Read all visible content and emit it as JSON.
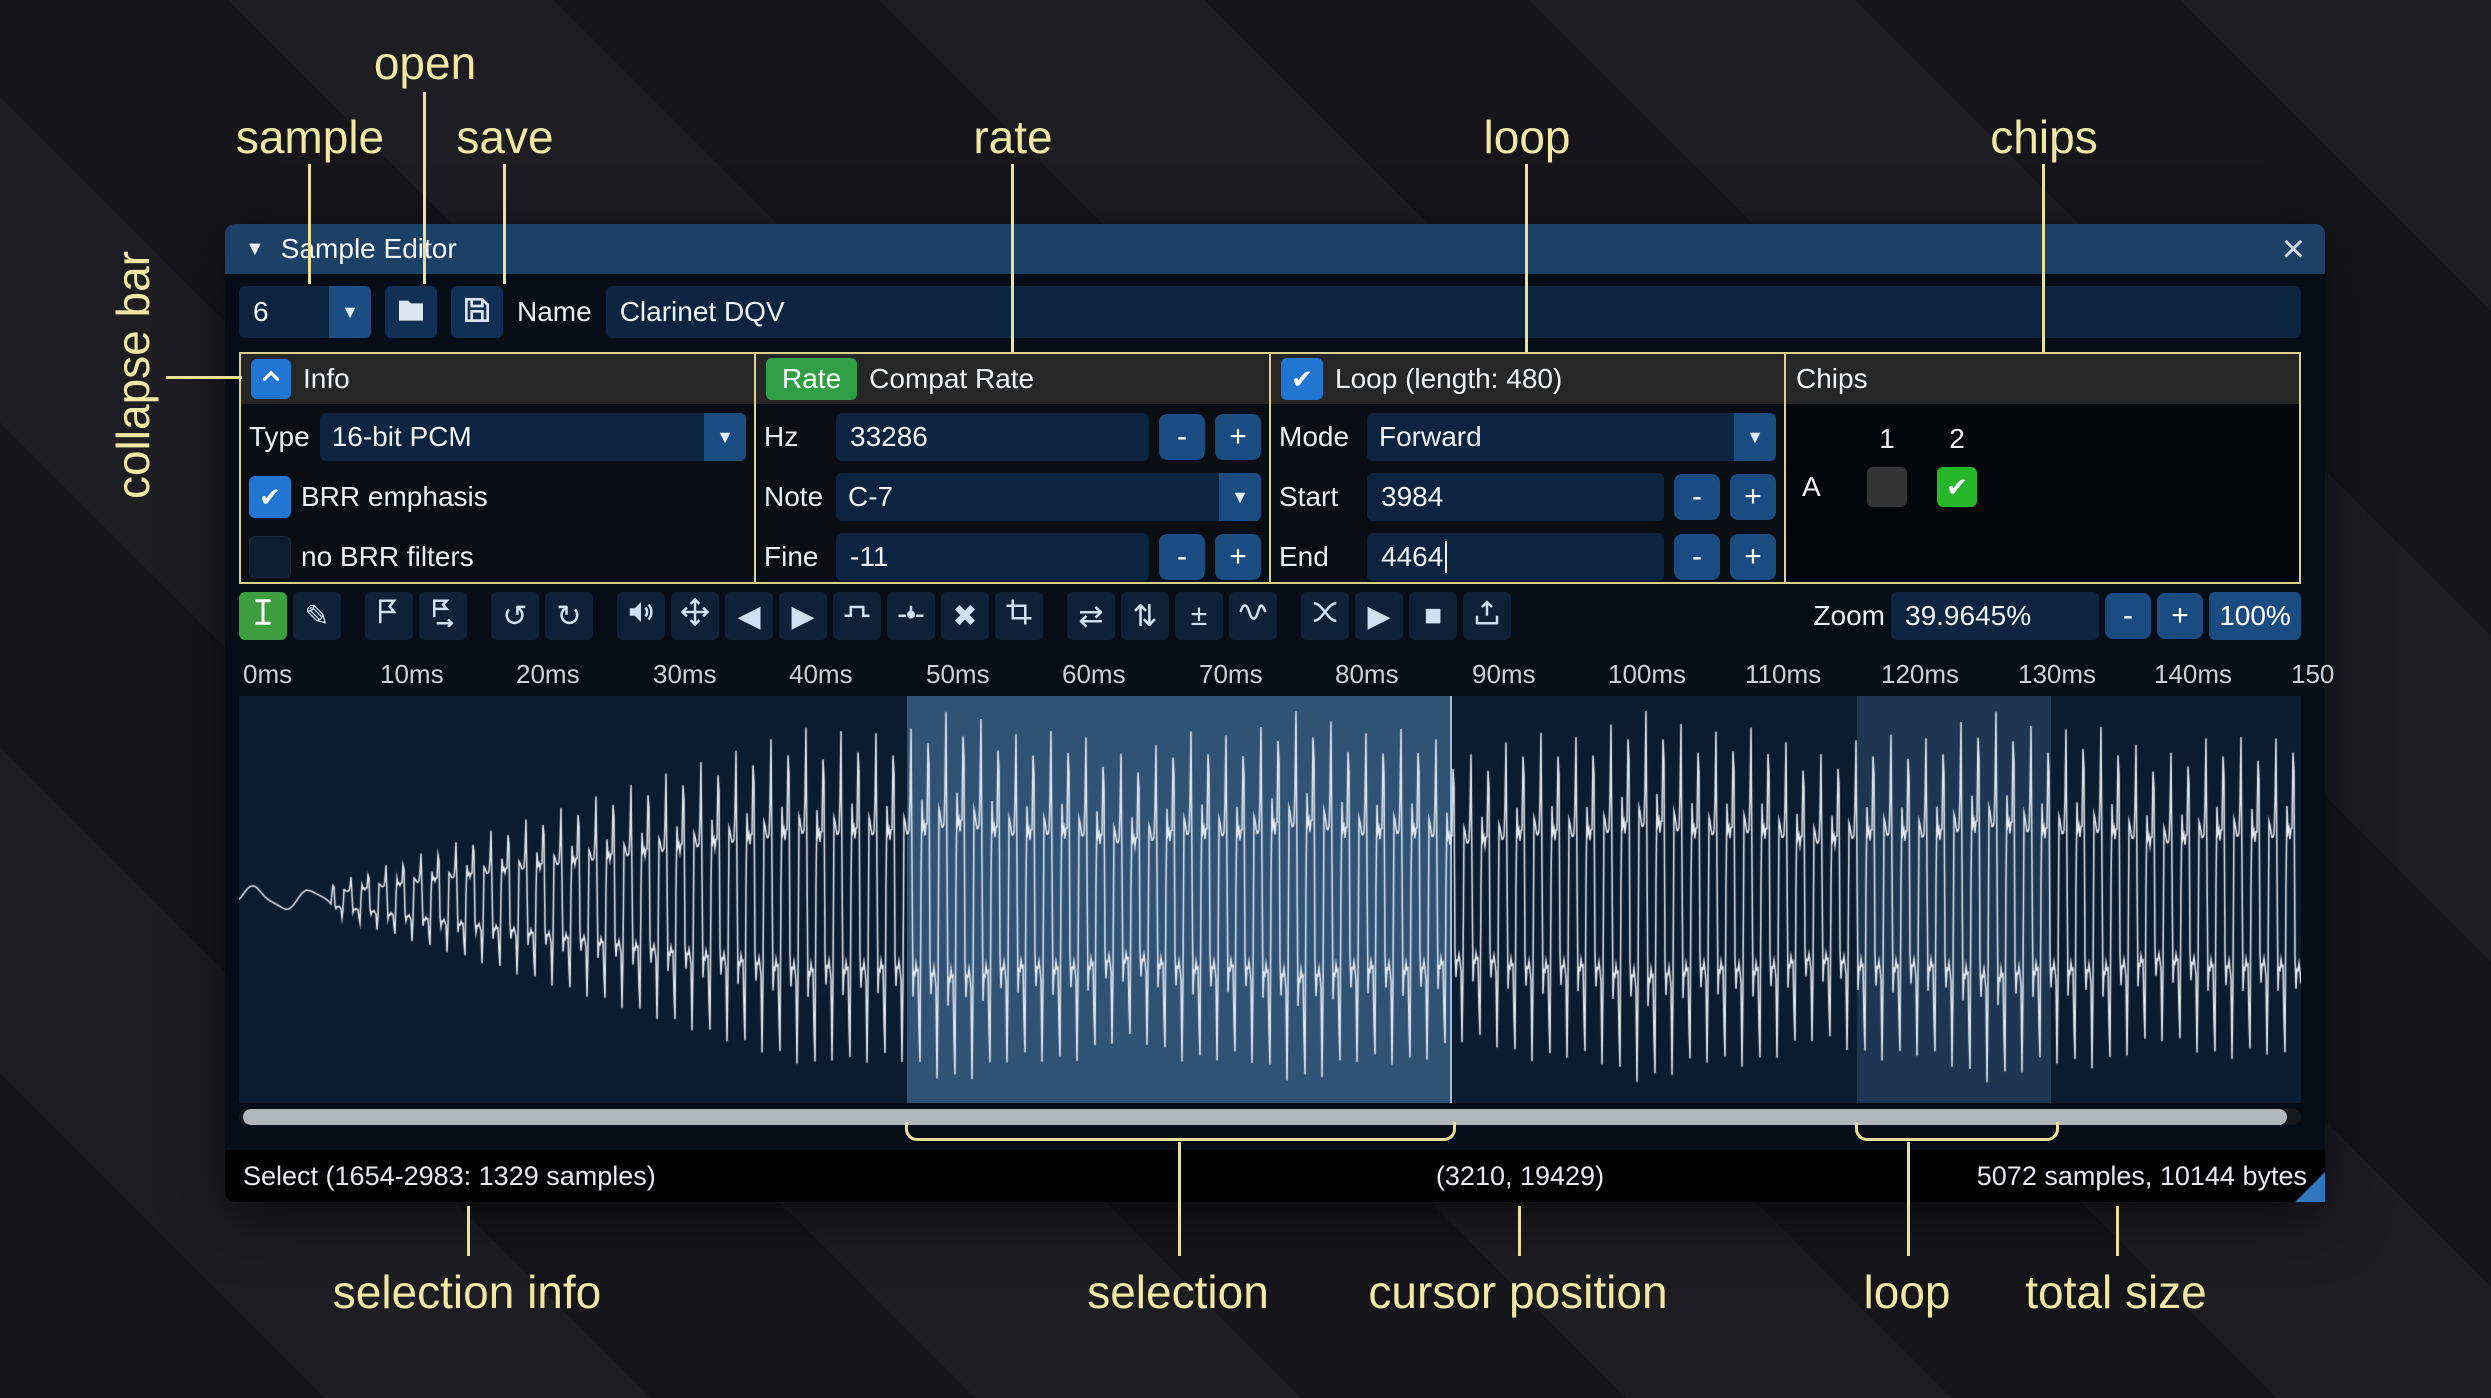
{
  "colors": {
    "accent_blue": "#2176d2",
    "accent_green": "#2f9e44",
    "chip_green": "#27b52a",
    "annotation_yellow": "#f0e8a3",
    "selection_blue": "#5e94cd",
    "titlebar_blue": "#1d4166"
  },
  "glyphs": {
    "collapse_triangle": "▼",
    "dropdown_caret": "▼",
    "close": "×",
    "check": "✔",
    "pencil": "✎",
    "undo": "↺",
    "redo": "↻",
    "fade_in": "◀",
    "fade_out": "▶",
    "delete": "✖",
    "reverse": "⇄",
    "invert": "⇅",
    "sign": "±",
    "play": "▶",
    "stop": "■"
  },
  "annotations": {
    "open": "open",
    "sample": "sample",
    "save": "save",
    "rate": "rate",
    "loop_top": "loop",
    "chips": "chips",
    "collapse_bar": "collapse bar",
    "selection_info": "selection info",
    "selection": "selection",
    "cursor_position": "cursor position",
    "loop_bottom": "loop",
    "total_size": "total size"
  },
  "titlebar": {
    "title": "Sample Editor"
  },
  "header_row": {
    "sample_number": "6",
    "name_label": "Name",
    "name_value": "Clarinet DQV"
  },
  "info_box": {
    "title": "Info",
    "type_label": "Type",
    "type_value": "16-bit PCM",
    "brr_emphasis": "BRR emphasis",
    "no_brr_filters": "no BRR filters"
  },
  "rate_box": {
    "button": "Rate",
    "title": "Compat Rate",
    "hz_label": "Hz",
    "hz_value": "33286",
    "note_label": "Note",
    "note_value": "C-7",
    "fine_label": "Fine",
    "fine_value": "-11"
  },
  "loop_box": {
    "title": "Loop (length: 480)",
    "mode_label": "Mode",
    "mode_value": "Forward",
    "start_label": "Start",
    "start_value": "3984",
    "end_label": "End",
    "end_value": "4464"
  },
  "chips_box": {
    "title": "Chips",
    "col_1": "1",
    "col_2": "2",
    "row_a": "A"
  },
  "spinner": {
    "minus": "-",
    "plus": "+"
  },
  "toolbar": {
    "zoom_label": "Zoom",
    "zoom_value": "39.9645%",
    "zoom_reset": "100%"
  },
  "ruler": {
    "labels": [
      "0ms",
      "10ms",
      "20ms",
      "30ms",
      "40ms",
      "50ms",
      "60ms",
      "70ms",
      "80ms",
      "90ms",
      "100ms",
      "110ms",
      "120ms",
      "130ms",
      "140ms",
      "150"
    ]
  },
  "status_bar": {
    "selection_info": "Select (1654-2983: 1329 samples)",
    "cursor_position": "(3210, 19429)",
    "total_size": "5072 samples, 10144 bytes"
  }
}
